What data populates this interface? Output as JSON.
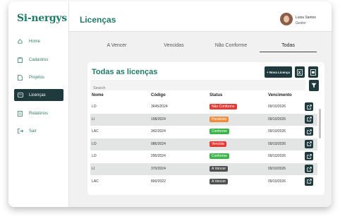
{
  "brand": {
    "logo_text": "Si-nergys"
  },
  "sidebar": {
    "items": [
      {
        "label": "Home",
        "icon": "home-icon",
        "active": false
      },
      {
        "label": "Cadastros",
        "icon": "clipboard-icon",
        "active": false
      },
      {
        "label": "Projetos",
        "icon": "document-icon",
        "active": false
      },
      {
        "label": "Licenças",
        "icon": "license-icon",
        "active": true
      },
      {
        "label": "Relatórios",
        "icon": "report-icon",
        "active": false
      },
      {
        "label": "Sair",
        "icon": "logout-icon",
        "active": false
      }
    ]
  },
  "header": {
    "title": "Licenças",
    "user_name": "Luisa Santos",
    "user_role": "Gestor"
  },
  "tabs": [
    {
      "label": "A Vencer",
      "active": false
    },
    {
      "label": "Vencidas",
      "active": false
    },
    {
      "label": "Não Conforme",
      "active": false
    },
    {
      "label": "Todas",
      "active": true
    }
  ],
  "card": {
    "title": "Todas as licenças",
    "new_button": "+ Nova Licença",
    "excel_icon": "excel-icon",
    "pdf_icon": "pdf-icon",
    "filter_icon": "filter-icon"
  },
  "search": {
    "placeholder": "Search"
  },
  "table": {
    "headers": [
      "Nome",
      "Código",
      "Status",
      "Vencimento"
    ],
    "rows": [
      {
        "nome": "LO",
        "codigo": "3645/2024",
        "status": "Não Conforme",
        "status_color": "#e53935",
        "vencimento": "09/10/2026"
      },
      {
        "nome": "LI",
        "codigo": "198/2024",
        "status": "Pendente",
        "status_color": "#f08c3a",
        "vencimento": "09/10/2026"
      },
      {
        "nome": "LAC",
        "codigo": "342/2024",
        "status": "Conforme",
        "status_color": "#3bb54a",
        "vencimento": "09/10/2026"
      },
      {
        "nome": "LO",
        "codigo": "086/2024",
        "status": "Vencida",
        "status_color": "#e53935",
        "vencimento": "09/10/2026"
      },
      {
        "nome": "LO",
        "codigo": "295/2024",
        "status": "Conforme",
        "status_color": "#3bb54a",
        "vencimento": "09/10/2026"
      },
      {
        "nome": "LI",
        "codigo": "370/2024",
        "status": "A Vencer",
        "status_color": "#505050",
        "vencimento": "09/10/2026"
      },
      {
        "nome": "LAC",
        "codigo": "800/2022",
        "status": "A Vencer",
        "status_color": "#505050",
        "vencimento": "09/10/2026"
      }
    ]
  },
  "colors": {
    "brand_green": "#1f7a66",
    "dark_teal": "#1e3a3d"
  }
}
